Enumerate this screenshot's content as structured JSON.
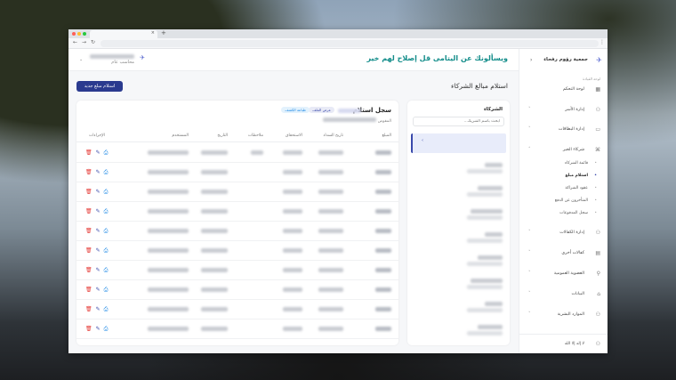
{
  "browser": {
    "tab_title": "",
    "new_tab": "+"
  },
  "header": {
    "motto": "ويسألونك عن اليتامى قل إصلاح لهم خير",
    "user_role": "محاسب عام"
  },
  "page": {
    "title": "استلام مبالغ الشركاء",
    "new_button": "استلام مبلغ جديد"
  },
  "partners": {
    "title": "الشركاء",
    "search_placeholder": "ابحث باسم الشريك..."
  },
  "records": {
    "title": "سجل استلام",
    "badge_view": "عرض الملف",
    "badge_print": "طباعة الكشف",
    "subtitle": "المفوض",
    "columns": [
      "المبلغ",
      "تاريخ السداد",
      "الاستحقاق",
      "ملاحظات",
      "التاريخ",
      "المستخدم",
      "الإجراءات"
    ],
    "row_count": 10
  },
  "sidebar": {
    "brand": "جمعية رؤوم رفحاء",
    "section": "لوحة القيادة",
    "items": [
      {
        "label": "لوحة التحكم",
        "icon": "grid-icon"
      },
      {
        "label": "إدارة الأسر",
        "icon": "users-icon"
      },
      {
        "label": "إدارة البطاقات",
        "icon": "card-icon"
      },
      {
        "label": "شركاء الخير",
        "icon": "handshake-icon"
      }
    ],
    "subitems": [
      "قائمة الشركاء",
      "استلام مبلغ",
      "عقود الشراكة",
      "المتأخرون عن الدفع",
      "سجل المدفوعات"
    ],
    "items2": [
      {
        "label": "إدارة الكفالات",
        "icon": "users-icon"
      },
      {
        "label": "كفالات أخرى",
        "icon": "file-icon"
      },
      {
        "label": "العضوية العمومية",
        "icon": "user-icon"
      },
      {
        "label": "البيانات",
        "icon": "box-icon"
      },
      {
        "label": "الموارد البشرية",
        "icon": "users-icon"
      }
    ],
    "footer": "لا إله إلا الله"
  },
  "colors": {
    "primary": "#2a3a8f",
    "motto": "#138d8a",
    "delete": "#e53935",
    "edit": "#3949ab",
    "print": "#1e88e5"
  }
}
